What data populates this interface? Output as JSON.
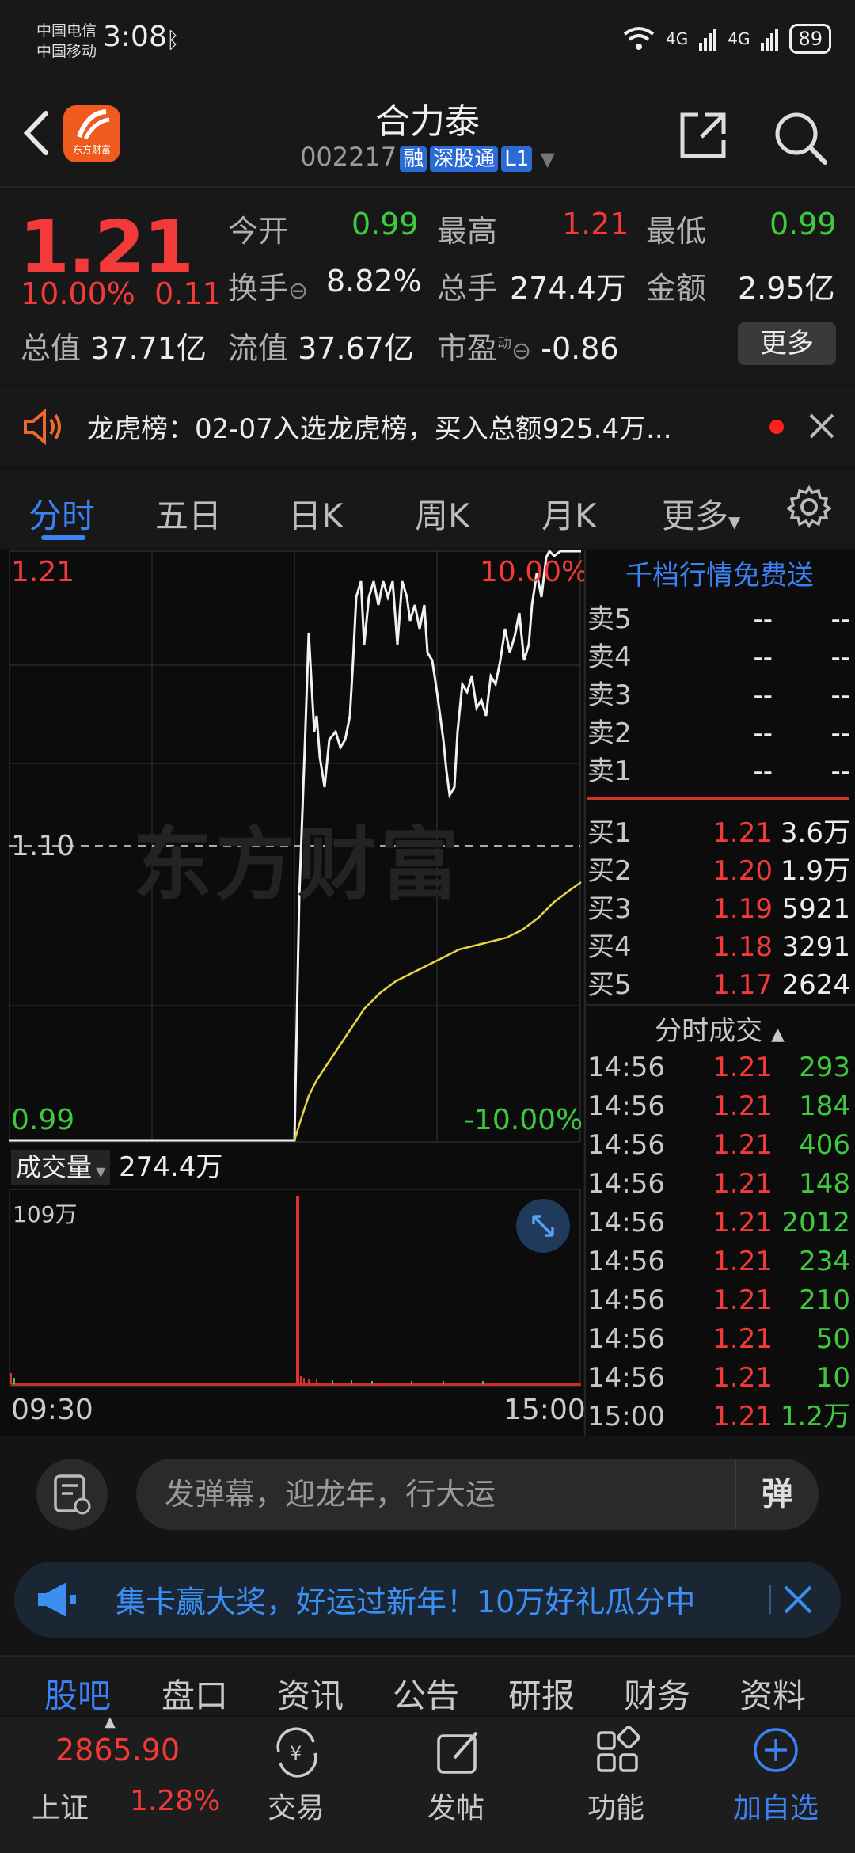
{
  "status_bar": {
    "carrier1": "中国电信",
    "carrier2": "中国移动",
    "time": "3:08",
    "net1": "4G",
    "net2": "4G",
    "battery": "89"
  },
  "header": {
    "logo_text": "东方财富",
    "stock_name": "合力泰",
    "stock_code": "002217",
    "tags": [
      "融",
      "深股通",
      "L1"
    ]
  },
  "quote": {
    "price": "1.21",
    "change_pct": "10.00%",
    "change_abs": "0.11",
    "open_label": "今开",
    "open": "0.99",
    "high_label": "最高",
    "high": "1.21",
    "low_label": "最低",
    "low": "0.99",
    "turnover_label": "换手",
    "turnover": "8.82%",
    "volume_label": "总手",
    "volume": "274.4万",
    "amount_label": "金额",
    "amount": "2.95亿",
    "mktcap_label": "总值",
    "mktcap": "37.71亿",
    "float_label": "流值",
    "float": "37.67亿",
    "pe_label": "市盈",
    "pe_sup": "动",
    "pe": "-0.86",
    "more": "更多"
  },
  "notice": {
    "text": "龙虎榜：02-07入选龙虎榜，买入总额925.4万..."
  },
  "tabs": [
    "分时",
    "五日",
    "日K",
    "周K",
    "月K",
    "更多"
  ],
  "chart": {
    "top_price": "1.21",
    "top_pct": "10.00%",
    "mid_price": "1.10",
    "bottom_price": "0.99",
    "bottom_pct": "-10.00%",
    "watermark": "东方财富",
    "vol_label": "成交量",
    "vol_value": "274.4万",
    "vol_max": "109万",
    "time_start": "09:30",
    "time_end": "15:00"
  },
  "order_book": {
    "header": "千档行情免费送",
    "asks": [
      {
        "label": "卖5",
        "price": "--",
        "vol": "--"
      },
      {
        "label": "卖4",
        "price": "--",
        "vol": "--"
      },
      {
        "label": "卖3",
        "price": "--",
        "vol": "--"
      },
      {
        "label": "卖2",
        "price": "--",
        "vol": "--"
      },
      {
        "label": "卖1",
        "price": "--",
        "vol": "--"
      }
    ],
    "bids": [
      {
        "label": "买1",
        "price": "1.21",
        "vol": "3.6万"
      },
      {
        "label": "买2",
        "price": "1.20",
        "vol": "1.9万"
      },
      {
        "label": "买3",
        "price": "1.19",
        "vol": "5921"
      },
      {
        "label": "买4",
        "price": "1.18",
        "vol": "3291"
      },
      {
        "label": "买5",
        "price": "1.17",
        "vol": "2624"
      }
    ],
    "ticks_header": "分时成交",
    "ticks": [
      {
        "time": "14:56",
        "price": "1.21",
        "vol": "293"
      },
      {
        "time": "14:56",
        "price": "1.21",
        "vol": "184"
      },
      {
        "time": "14:56",
        "price": "1.21",
        "vol": "406"
      },
      {
        "time": "14:56",
        "price": "1.21",
        "vol": "148"
      },
      {
        "time": "14:56",
        "price": "1.21",
        "vol": "2012"
      },
      {
        "time": "14:56",
        "price": "1.21",
        "vol": "234"
      },
      {
        "time": "14:56",
        "price": "1.21",
        "vol": "210"
      },
      {
        "time": "14:56",
        "price": "1.21",
        "vol": "50"
      },
      {
        "time": "14:56",
        "price": "1.21",
        "vol": "10"
      },
      {
        "time": "15:00",
        "price": "1.21",
        "vol": "1.2万"
      }
    ]
  },
  "comment": {
    "placeholder": "发弹幕，迎龙年，行大运",
    "danmu_btn": "弹"
  },
  "promo": {
    "text": "集卡赢大奖，好运过新年！10万好礼瓜分中"
  },
  "bottom_tabs": [
    "股吧",
    "盘口",
    "资讯",
    "公告",
    "研报",
    "财务",
    "资料"
  ],
  "nav": {
    "index_value": "2865.90",
    "index_name": "上证",
    "index_pct": "1.28%",
    "trade": "交易",
    "post": "发帖",
    "function": "功能",
    "add_watch": "加自选"
  },
  "colors": {
    "up": "#f23a3a",
    "down": "#3fc93f",
    "accent": "#3b82f6",
    "avg_line": "#e8d24a"
  }
}
